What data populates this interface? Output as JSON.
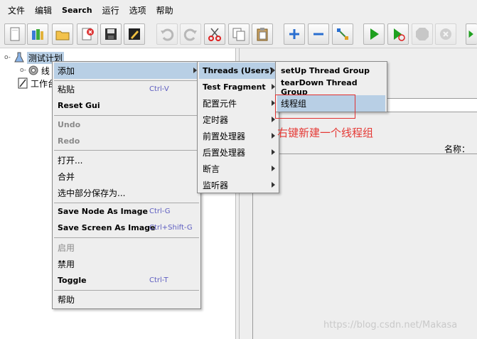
{
  "menubar": [
    "文件",
    "编辑",
    "Search",
    "运行",
    "选项",
    "帮助"
  ],
  "toolbar": [
    {
      "name": "new-icon"
    },
    {
      "name": "templates-icon"
    },
    {
      "name": "open-icon"
    },
    {
      "name": "close-icon"
    },
    {
      "name": "save-icon"
    },
    {
      "name": "edit-icon"
    },
    {
      "name": "undo-icon"
    },
    {
      "name": "redo-icon"
    },
    {
      "name": "cut-icon"
    },
    {
      "name": "copy-icon"
    },
    {
      "name": "paste-icon"
    },
    {
      "name": "expand-icon"
    },
    {
      "name": "collapse-icon"
    },
    {
      "name": "toggle-icon"
    },
    {
      "name": "start-icon"
    },
    {
      "name": "start-no-timers-icon"
    },
    {
      "name": "stop-icon"
    },
    {
      "name": "shutdown-icon"
    },
    {
      "name": "remote-start-icon"
    }
  ],
  "tree": {
    "test_plan": "测试计划",
    "thread_group_partial": "线",
    "workbench_partial": "工作台"
  },
  "context_menu": {
    "add": "添加",
    "paste": "粘贴",
    "paste_accel": "Ctrl-V",
    "reset_gui": "Reset Gui",
    "undo": "Undo",
    "redo": "Redo",
    "open": "打开...",
    "merge": "合并",
    "save_selection": "选中部分保存为...",
    "save_node_image": "Save Node As Image",
    "save_node_accel": "Ctrl-G",
    "save_screen_image": "Save Screen As Image",
    "save_screen_accel": "Ctrl+Shift-G",
    "enable": "启用",
    "disable": "禁用",
    "toggle": "Toggle",
    "toggle_accel": "Ctrl-T",
    "help": "帮助"
  },
  "add_submenu": {
    "threads": "Threads (Users)",
    "test_fragment": "Test Fragment",
    "config": "配置元件",
    "timer": "定时器",
    "pre_processor": "前置处理器",
    "post_processor": "后置处理器",
    "assertion": "断言",
    "listener": "监听器"
  },
  "threads_submenu": {
    "setup": "setUp Thread Group",
    "teardown": "tearDown Thread Group",
    "thread_group": "线程组"
  },
  "right_pane": {
    "name_label": "名称："
  },
  "annotation": "右键新建一个线程组",
  "watermark": "https://blog.csdn.net/Makasa",
  "colors": {
    "menu_highlight": "#b8cfe5",
    "annotation_red": "#e53935",
    "accelerator": "#5d5dc0"
  }
}
